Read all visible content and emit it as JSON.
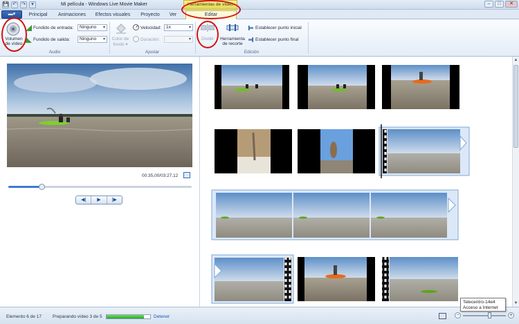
{
  "window": {
    "title": "Mi película - Windows Live Movie Maker",
    "context_tab": "Herramientas de vídeo",
    "controls": {
      "minimize": "–",
      "maximize": "□",
      "close": "✕"
    }
  },
  "quick_access": {
    "save_icon": "💾",
    "undo_icon": "↶",
    "redo_icon": "↷",
    "dropdown_icon": "▾"
  },
  "app_button": "▬▾",
  "tabs": [
    "Principal",
    "Animaciones",
    "Efectos visuales",
    "Proyecto",
    "Ver",
    "Editar"
  ],
  "active_tab": "Editar",
  "ribbon": {
    "audio": {
      "volume_label_1": "Volumen",
      "volume_label_2": "de vídeo",
      "fade_in_label": "Fundido de entrada:",
      "fade_in_value": "Ninguno",
      "fade_out_label": "Fundido de salida:",
      "fade_out_value": "Ninguno",
      "group": "Audio"
    },
    "adjust": {
      "bg_color_1": "Color de",
      "bg_color_2": "fondo ▾",
      "speed_label": "Velocidad:",
      "speed_value": "1x",
      "duration_label": "Duración:",
      "duration_value": "",
      "group": "Ajustar"
    },
    "edit": {
      "split": "Dividir",
      "trim_1": "Herramienta",
      "trim_2": "de recorte",
      "set_start": "Establecer punto inicial",
      "set_end": "Establecer punto final",
      "group": "Edición"
    }
  },
  "player": {
    "timecode": "00:35,00/03:27,12",
    "progress": 0.18,
    "prev_icon": "◀|",
    "play_icon": "▶",
    "next_icon": "|▶"
  },
  "status": {
    "item": "Elemento 6 de 17",
    "preparing": "Preparando vídeo 3 de 5",
    "progress": 0.85,
    "stop": "Detener"
  },
  "tooltip": {
    "line1": "Telecentro-14e4",
    "line2": "Acceso a Internet"
  },
  "zoom": {
    "minus": "−",
    "plus": "+",
    "level": 0.62
  },
  "colors": {
    "annotation": "#d41212",
    "accent": "#3d7ad6",
    "context": "#e3d64a"
  }
}
